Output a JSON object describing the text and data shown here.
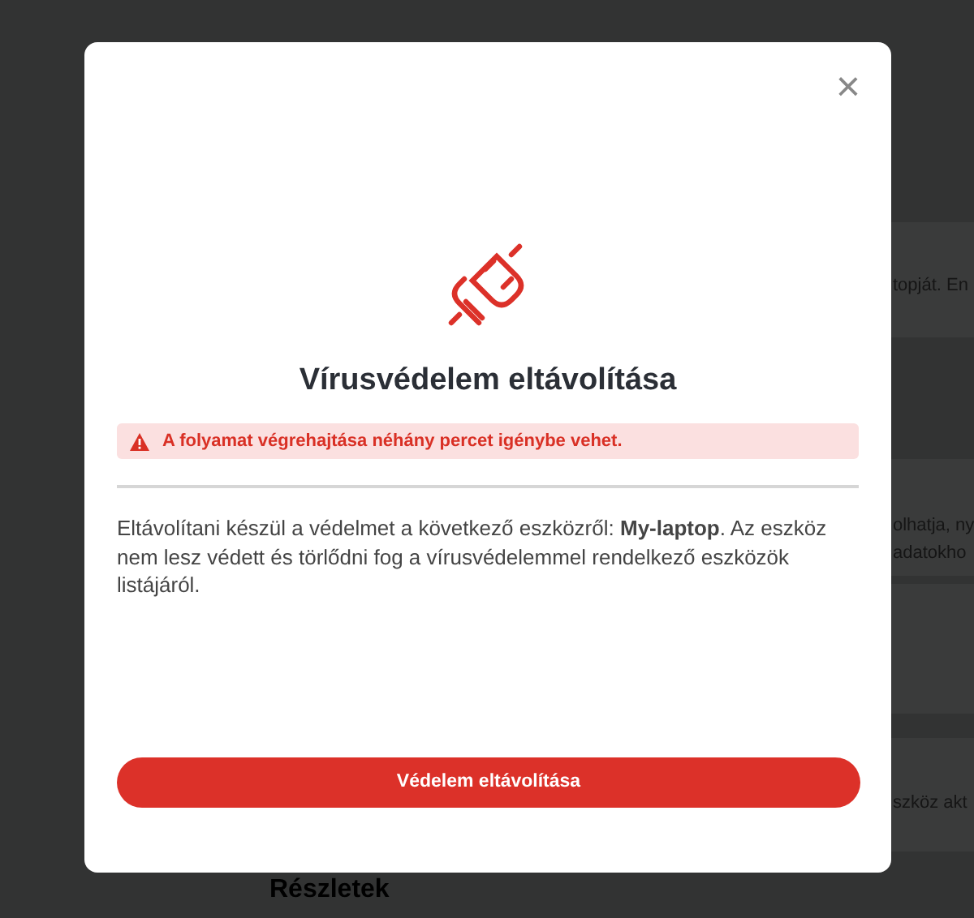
{
  "background": {
    "cards": [
      {
        "text": "topját. En"
      },
      {
        "text": "olhatja, ny",
        "text_2": "adatokho"
      },
      {
        "text": "szköz akt"
      }
    ],
    "section_heading": "Részletek"
  },
  "dialog": {
    "close": "×",
    "title": "Vírusvédelem eltávolítása",
    "warning": "A folyamat végrehajtása néhány percet igénybe vehet.",
    "body": "Eltávolítani készül a védelmet a következő eszközről: **My-laptop**. Az eszköz nem lesz védett és törlődni fog a vírusvédelemmel rendelkező eszközök listájáról.",
    "button": "Védelem eltávolítása"
  }
}
